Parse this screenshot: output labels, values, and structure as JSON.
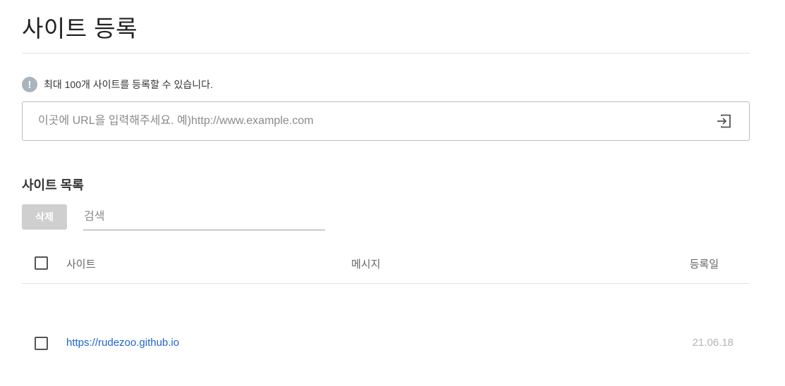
{
  "page": {
    "title": "사이트 등록"
  },
  "notice": {
    "icon": "info-exclamation-icon",
    "text": "최대 100개 사이트를 등록할 수 있습니다."
  },
  "url_input": {
    "placeholder": "이곳에 URL을 입력해주세요. 예)http://www.example.com",
    "value": "",
    "submit_icon": "login-arrow-icon"
  },
  "site_list": {
    "title": "사이트 목록",
    "delete_label": "삭제",
    "search_placeholder": "검색",
    "columns": {
      "site": "사이트",
      "message": "메시지",
      "date": "등록일"
    },
    "rows": [
      {
        "site": "https://rudezoo.github.io",
        "message": "",
        "date": "21.06.18",
        "checked": false
      }
    ]
  },
  "colors": {
    "link": "#1e64c8",
    "disabled_button": "#cfcfcf",
    "notice_icon": "#a9b4bd"
  }
}
